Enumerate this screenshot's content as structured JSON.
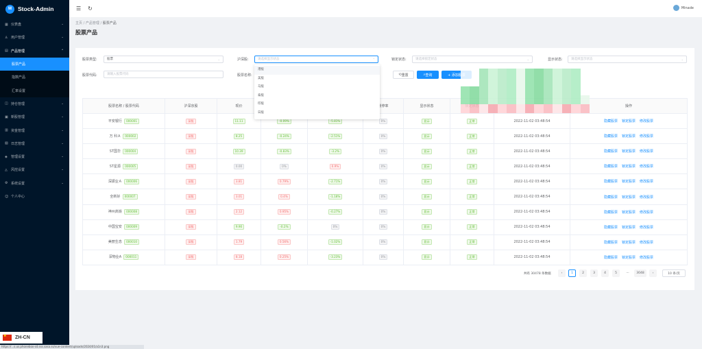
{
  "app": {
    "title": "Stock-Admin",
    "logo_text": "M"
  },
  "sidebar": {
    "items": [
      {
        "label": "仪表盘",
        "icon": "dashboard-icon"
      },
      {
        "label": "用户管理",
        "icon": "user-icon"
      },
      {
        "label": "产品管理",
        "icon": "product-icon",
        "open": true,
        "children": [
          {
            "label": "股票产品",
            "active": true
          },
          {
            "label": "指数产品"
          },
          {
            "label": "汇率设置"
          }
        ]
      },
      {
        "label": "持仓管理",
        "icon": "position-icon"
      },
      {
        "label": "新股管理",
        "icon": "ipo-icon"
      },
      {
        "label": "资金管理",
        "icon": "wallet-icon"
      },
      {
        "label": "日志管理",
        "icon": "log-icon"
      },
      {
        "label": "管理设置",
        "icon": "admin-icon"
      },
      {
        "label": "风控设置",
        "icon": "risk-icon"
      },
      {
        "label": "系统设置",
        "icon": "gear-icon"
      },
      {
        "label": "个人中心",
        "icon": "person-icon"
      }
    ]
  },
  "lang": {
    "label": "ZH-CN"
  },
  "statusbar": {
    "url": "https://...s.us.phonebox-s4.sss.sasa.ss/vue-content/uploads/2024/01/a1n3.png"
  },
  "header": {
    "username": "Minade"
  },
  "breadcrumb": {
    "items": [
      "主页",
      "产品管理",
      "股票产品"
    ],
    "sep": "/"
  },
  "page": {
    "title": "股票产品"
  },
  "filters": {
    "type_label": "股票类型:",
    "type_value": "股票",
    "board_label": "沪深股:",
    "board_placeholder": "请选择显示状态",
    "lock_label": "锁定状态:",
    "lock_placeholder": "请选择锁定状态",
    "display_label": "显示状态:",
    "display_placeholder": "请选择显示状态",
    "code_label": "股票代码:",
    "code_placeholder": "请输入股票代码",
    "name_label": "股票名称:",
    "reset": "重置",
    "search": "查询",
    "add": "+ 添加股票"
  },
  "dropdown": {
    "options": [
      "港股",
      "美股",
      "马股",
      "泰股",
      "印股",
      "日股"
    ]
  },
  "table": {
    "headers": [
      "股票名称 / 股票代码",
      "沪深京股",
      "现价",
      "涨跌",
      "涨跌幅",
      "涨停率",
      "显示状态",
      "锁定状态",
      "",
      "操作"
    ],
    "rows": [
      {
        "name": "平安银行",
        "code": "000001",
        "board": "深股",
        "price": "11.11",
        "chg": "-0.09%",
        "pct": "-5.81%",
        "rate": "0%",
        "show": "显示",
        "lock": "正常",
        "time": "2022-11-02 03:48:54"
      },
      {
        "name": "万 科Ａ",
        "code": "000002",
        "board": "深股",
        "price": "8.25",
        "chg": "-0.24%",
        "pct": "-2.51%",
        "rate": "0%",
        "show": "显示",
        "lock": "正常",
        "time": "2022-11-02 03:48:54"
      },
      {
        "name": "ST国华",
        "code": "000004",
        "board": "深股",
        "price": "10.39",
        "chg": "-0.83%",
        "pct": "-3.2%",
        "rate": "0%",
        "show": "显示",
        "lock": "正常",
        "time": "2022-11-02 03:48:54"
      },
      {
        "name": "ST星源",
        "code": "000005",
        "board": "深股",
        "price": "0.00",
        "chg": "0%",
        "pct": "0.9%",
        "rate": "0%",
        "show": "显示",
        "lock": "正常",
        "time": "2022-11-02 03:48:54"
      },
      {
        "name": "深振业Ａ",
        "code": "000006",
        "board": "深股",
        "price": "3.81",
        "chg": "0.79%",
        "pct": "-2.71%",
        "rate": "0%",
        "show": "显示",
        "lock": "正常",
        "time": "2022-11-02 03:48:54"
      },
      {
        "name": "全新好",
        "code": "000007",
        "board": "深股",
        "price": "3.01",
        "chg": "0.4%",
        "pct": "-1.18%",
        "rate": "0%",
        "show": "显示",
        "lock": "正常",
        "time": "2022-11-02 03:48:54"
      },
      {
        "name": "神州高铁",
        "code": "000008",
        "board": "深股",
        "price": "2.12",
        "chg": "0.95%",
        "pct": "-0.27%",
        "rate": "0%",
        "show": "显示",
        "lock": "正常",
        "time": "2022-11-02 03:48:54"
      },
      {
        "name": "中国宝安",
        "code": "000009",
        "board": "深股",
        "price": "9.90",
        "chg": "-0.2%",
        "pct": "0%",
        "rate": "0%",
        "show": "显示",
        "lock": "正常",
        "time": "2022-11-02 03:48:54"
      },
      {
        "name": "美丽生态",
        "code": "000010",
        "board": "深股",
        "price": "1.79",
        "chg": "0.56%",
        "pct": "-1.02%",
        "rate": "0%",
        "show": "显示",
        "lock": "正常",
        "time": "2022-11-02 03:48:54"
      },
      {
        "name": "深物业A",
        "code": "000011",
        "board": "深股",
        "price": "8.18",
        "chg": "0.25%",
        "pct": "-3.23%",
        "rate": "0%",
        "show": "显示",
        "lock": "正常",
        "time": "2022-11-02 03:48:54"
      }
    ],
    "actions": [
      "隐藏股票",
      "锁定股票",
      "修改股票"
    ]
  },
  "pagination": {
    "total": "共有 30478 条数据",
    "pages": [
      "1",
      "2",
      "3",
      "4",
      "5"
    ],
    "ellipsis": "···",
    "last": "3048",
    "prev": "‹",
    "next": "›",
    "size": "10 条/页"
  },
  "colors": {
    "sidebar": "#001529",
    "primary": "#1890ff",
    "green": "#67c23a",
    "red": "#f56c6c"
  }
}
